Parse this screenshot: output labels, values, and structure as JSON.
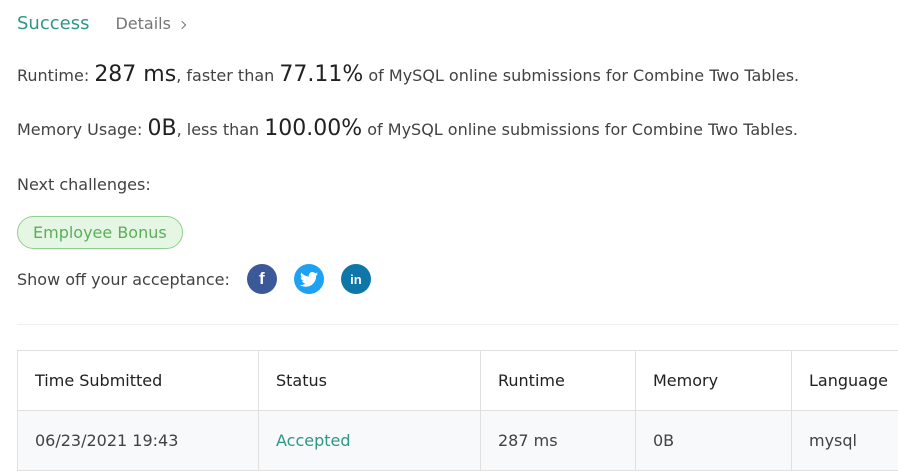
{
  "header": {
    "status_label": "Success",
    "details_label": "Details"
  },
  "runtime": {
    "label": "Runtime:",
    "value": "287 ms",
    "mid": ", faster than",
    "percent": "77.11%",
    "suffix": "of MySQL online submissions for Combine Two Tables."
  },
  "memory": {
    "label": "Memory Usage:",
    "value": "0B",
    "mid": ", less than",
    "percent": "100.00%",
    "suffix": "of MySQL online submissions for Combine Two Tables."
  },
  "next_challenges": {
    "label": "Next challenges:",
    "items": [
      "Employee Bonus"
    ]
  },
  "share": {
    "label": "Show off your acceptance:",
    "icons": [
      "facebook-icon",
      "twitter-icon",
      "linkedin-icon"
    ]
  },
  "colors": {
    "accent": "#2f9688",
    "chip_bg": "#e6f6e5",
    "chip_border": "#8fcf8e",
    "facebook": "#3b5998",
    "twitter": "#1da1f2",
    "linkedin": "#0e76a8"
  },
  "table": {
    "headers": [
      "Time Submitted",
      "Status",
      "Runtime",
      "Memory",
      "Language"
    ],
    "rows": [
      [
        "06/23/2021 19:43",
        "Accepted",
        "287 ms",
        "0B",
        "mysql"
      ]
    ]
  }
}
